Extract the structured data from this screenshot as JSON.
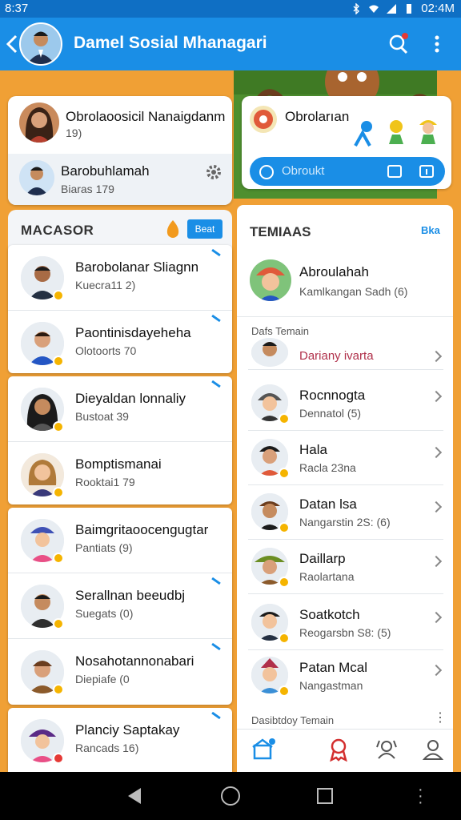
{
  "status": {
    "time": "8:37",
    "clock_right": "02:4M"
  },
  "appbar": {
    "title": "Damel Sosial Mhanagari",
    "back_icon": "arrow-left-icon",
    "search_icon": "search-user-icon",
    "more_icon": "more-vertical-icon",
    "notification_dot": true
  },
  "colors": {
    "primary": "#1a8ee6",
    "status": "#0f6fc4",
    "background": "#f0a035",
    "badge": "#f5b400"
  },
  "header_card": {
    "primary": {
      "name": "Obrolaoosicil Nanaigdanm",
      "sub": "19)"
    },
    "secondary": {
      "name": "Barobuhlamah",
      "sub": "Biaras 179"
    }
  },
  "info_card": {
    "title": "Obrolarıan",
    "search_placeholder": "Obroukt"
  },
  "left_section": {
    "title": "MACASOR",
    "button": "Beat"
  },
  "left_list": [
    {
      "name": "Barobolanar Sliagnn",
      "sub": "Kuecra11 2)"
    },
    {
      "name": "Paontinisdayeheha",
      "sub": "Olotoorts 70"
    },
    {
      "name": "Dieyaldan lonnaliy",
      "sub": "Bustoat 39"
    },
    {
      "name": "Bomptismanai",
      "sub": "Rooktai1 79"
    },
    {
      "name": "Baimgritaoocengugtar",
      "sub": "Pantiats (9)"
    },
    {
      "name": "Serallnan beeudbj",
      "sub": "Suegats (0)"
    },
    {
      "name": "Nosahotannonabari",
      "sub": "Diepiafe (0"
    },
    {
      "name": "Planciy Saptakay",
      "sub": "Rancads 16)"
    }
  ],
  "right_panel": {
    "title": "TEMIAAS",
    "link": "Bka",
    "featured": {
      "name": "Abroulahah",
      "sub": "Kamlkangan Sadh (6)"
    },
    "section_label": "Dafs Temain",
    "list": [
      {
        "name": "Dariany ivarta",
        "sub": ""
      },
      {
        "name": "Rocnnogta",
        "sub": "Dennatol (5)"
      },
      {
        "name": "Hala",
        "sub": "Racla 23na"
      },
      {
        "name": "Datan lsa",
        "sub": "Nangarstin 2S: (6)"
      },
      {
        "name": "Daillarp",
        "sub": "Raolartana"
      },
      {
        "name": "Soatkotch",
        "sub": "Reogarsbn S8: (5)"
      },
      {
        "name": "Patan Mcal",
        "sub": "Nangastman"
      }
    ],
    "footer_label": "Dasibtdoy Temain",
    "footer_more": "⋮"
  },
  "tabs": [
    {
      "icon": "home-badge-icon"
    },
    {
      "icon": "award-ribbon-icon"
    },
    {
      "icon": "user-group-icon"
    },
    {
      "icon": "profile-icon"
    }
  ]
}
